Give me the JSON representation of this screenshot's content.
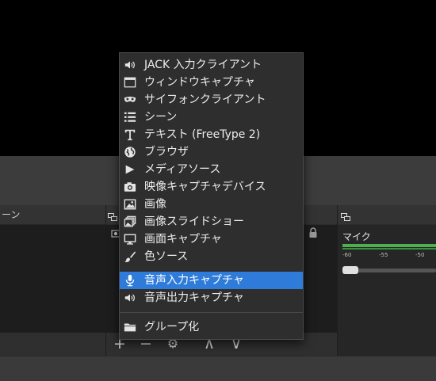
{
  "docks": {
    "scenes_title": "ーン",
    "mixer": {
      "channel_label": "マイク",
      "ticks": [
        "-60",
        "-55",
        "-50"
      ]
    }
  },
  "toolbar": {
    "add": "+",
    "remove": "−",
    "settings": "⚙",
    "up": "∧",
    "down": "∨"
  },
  "context_menu": {
    "items": [
      {
        "label": "JACK 入力クライアント",
        "icon": "speaker-icon"
      },
      {
        "label": "ウィンドウキャプチャ",
        "icon": "window-icon"
      },
      {
        "label": "サイフォンクライアント",
        "icon": "mask-icon"
      },
      {
        "label": "シーン",
        "icon": "list-icon"
      },
      {
        "label": "テキスト (FreeType 2)",
        "icon": "text-icon"
      },
      {
        "label": "ブラウザ",
        "icon": "globe-icon"
      },
      {
        "label": "メディアソース",
        "icon": "play-icon"
      },
      {
        "label": "映像キャプチャデバイス",
        "icon": "camera-icon"
      },
      {
        "label": "画像",
        "icon": "image-icon"
      },
      {
        "label": "画像スライドショー",
        "icon": "slideshow-icon"
      },
      {
        "label": "画面キャプチャ",
        "icon": "monitor-icon"
      },
      {
        "label": "色ソース",
        "icon": "brush-icon"
      },
      {
        "label": "音声入力キャプチャ",
        "icon": "microphone-icon",
        "selected": true
      },
      {
        "label": "音声出力キャプチャ",
        "icon": "speaker-icon"
      },
      {
        "label": "グループ化",
        "icon": "folder-icon"
      }
    ]
  },
  "colors": {
    "menu_bg": "#2e2e2e",
    "selection": "#2f7bd9",
    "meter_green": "#4caf50"
  }
}
